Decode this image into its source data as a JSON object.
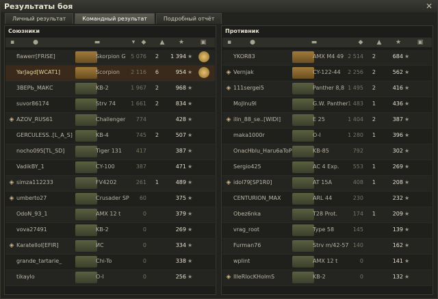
{
  "window": {
    "title": "Результаты боя"
  },
  "tabs": [
    {
      "label": "Личный результат"
    },
    {
      "label": "Командный результат"
    },
    {
      "label": "Подробный отчёт"
    }
  ],
  "allies": {
    "title": "Союзники",
    "rows": [
      {
        "name": "flawerr[FRISE]",
        "tank": "Skorpion G",
        "damage": "5 076",
        "frags": "2",
        "xp": "1 394",
        "medal": true,
        "top": true
      },
      {
        "name": "YarJagd[WCAT1]",
        "tank": "Scorpion",
        "damage": "2 116",
        "frags": "6",
        "xp": "954",
        "medal": true,
        "player": true,
        "top": true
      },
      {
        "name": "3ВЕРЬ_МАКС",
        "tank": "KB-2",
        "damage": "1 967",
        "frags": "2",
        "xp": "968"
      },
      {
        "name": "suvor86174",
        "tank": "Strv 74",
        "damage": "1 661",
        "frags": "2",
        "xp": "834"
      },
      {
        "name": "AZOV_RUS61",
        "tank": "Challenger",
        "damage": "774",
        "frags": "",
        "xp": "428",
        "squad": true
      },
      {
        "name": "GERCULESS..[L_A_S]",
        "tank": "KB-4",
        "damage": "745",
        "frags": "2",
        "xp": "507"
      },
      {
        "name": "nocho095[TL_SD]",
        "tank": "Tiger 131",
        "damage": "417",
        "frags": "",
        "xp": "387"
      },
      {
        "name": "VadikBY_1",
        "tank": "CY-100",
        "damage": "387",
        "frags": "",
        "xp": "471"
      },
      {
        "name": "simza112233",
        "tank": "FV4202",
        "damage": "261",
        "frags": "1",
        "xp": "489",
        "squad": true
      },
      {
        "name": "umberto27",
        "tank": "Crusader SP",
        "damage": "60",
        "frags": "",
        "xp": "375",
        "squad": true
      },
      {
        "name": "OdoN_93_1",
        "tank": "AMX 12 t",
        "damage": "0",
        "frags": "",
        "xp": "379"
      },
      {
        "name": "vova27491",
        "tank": "KB-2",
        "damage": "0",
        "frags": "",
        "xp": "269"
      },
      {
        "name": "Karatellol[EFIR]",
        "tank": "ИС",
        "damage": "0",
        "frags": "",
        "xp": "334",
        "squad": true
      },
      {
        "name": "grande_tartarie_",
        "tank": "Chi-To",
        "damage": "0",
        "frags": "",
        "xp": "338"
      },
      {
        "name": "tikaylo",
        "tank": "O-I",
        "damage": "0",
        "frags": "",
        "xp": "256"
      }
    ]
  },
  "enemies": {
    "title": "Противник",
    "rows": [
      {
        "name": "YKOR83",
        "tank": "AMX M4 49",
        "damage": "2 514",
        "frags": "2",
        "xp": "684",
        "top": true
      },
      {
        "name": "Vernjak",
        "tank": "CY-122-44",
        "damage": "2 256",
        "frags": "2",
        "xp": "562",
        "squad": true,
        "top": true
      },
      {
        "name": "111sergei5",
        "tank": "Panther 8,8",
        "damage": "1 495",
        "frags": "2",
        "xp": "416",
        "squad": true
      },
      {
        "name": "MoJlnu9l",
        "tank": "G.W. Panther",
        "damage": "1 483",
        "frags": "1",
        "xp": "436"
      },
      {
        "name": "ilin_88_se..[WIDI]",
        "tank": "E 25",
        "damage": "1 404",
        "frags": "2",
        "xp": "387",
        "squad": true
      },
      {
        "name": "maka1000r",
        "tank": "O-I",
        "damage": "1 280",
        "frags": "1",
        "xp": "396"
      },
      {
        "name": "OnacHblu_Haru6aToP",
        "tank": "KB-85",
        "damage": "792",
        "frags": "",
        "xp": "302"
      },
      {
        "name": "Sergio425",
        "tank": "AC 4 Exp.",
        "damage": "553",
        "frags": "1",
        "xp": "269"
      },
      {
        "name": "idol79[SP1R0]",
        "tank": "AT 15A",
        "damage": "408",
        "frags": "1",
        "xp": "208",
        "squad": true
      },
      {
        "name": "CENTURION_MAX",
        "tank": "ARL 44",
        "damage": "230",
        "frags": "",
        "xp": "232"
      },
      {
        "name": "Obez6nka",
        "tank": "T28 Prot.",
        "damage": "174",
        "frags": "1",
        "xp": "209"
      },
      {
        "name": "vrag_root",
        "tank": "Type 58",
        "damage": "145",
        "frags": "",
        "xp": "139"
      },
      {
        "name": "Furman76",
        "tank": "Strv m/42-57",
        "damage": "140",
        "frags": "",
        "xp": "162"
      },
      {
        "name": "wplint",
        "tank": "AMX 12 t",
        "damage": "0",
        "frags": "",
        "xp": "141"
      },
      {
        "name": "IlleRlocKHolmS",
        "tank": "KB-2",
        "damage": "0",
        "frags": "",
        "xp": "132",
        "squad": true
      }
    ]
  },
  "icons": {
    "close": "close-icon",
    "squad": "squad-icon",
    "star": "xp-star-icon",
    "medal": "medal-icon"
  }
}
